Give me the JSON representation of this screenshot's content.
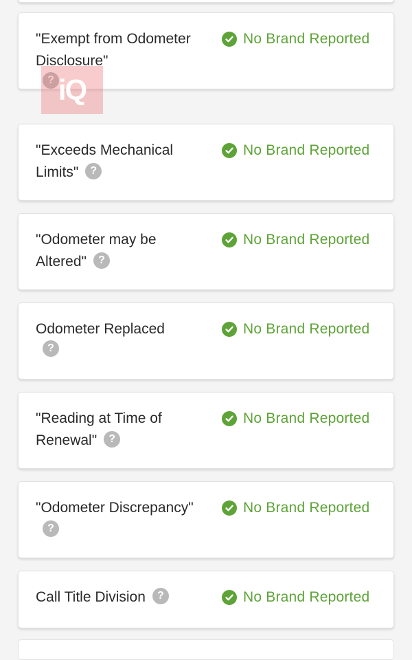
{
  "colors": {
    "accent_green": "#5da337",
    "help_gray": "#b9b9b9",
    "card_bg": "#ffffff",
    "page_bg": "#f4f4f4",
    "watermark": "#ec7878"
  },
  "help_icon": {
    "glyph": "?",
    "icon": "question-circle-icon"
  },
  "status_icon": "check-circle-icon",
  "watermark": {
    "text": "iQ"
  },
  "brands": [
    {
      "label": "\"Exempt from Odometer Disclosure\"",
      "status": "No Brand Reported"
    },
    {
      "label": "\"Exceeds Mechanical Limits\"",
      "status": "No Brand Reported"
    },
    {
      "label": "\"Odometer may be Altered\"",
      "status": "No Brand Reported"
    },
    {
      "label": "Odometer Replaced",
      "status": "No Brand Reported"
    },
    {
      "label": "\"Reading at Time of Renewal\"",
      "status": "No Brand Reported"
    },
    {
      "label": "\"Odometer Discrepancy\"",
      "status": "No Brand Reported"
    },
    {
      "label": "Call Title Division",
      "status": "No Brand Reported"
    }
  ]
}
